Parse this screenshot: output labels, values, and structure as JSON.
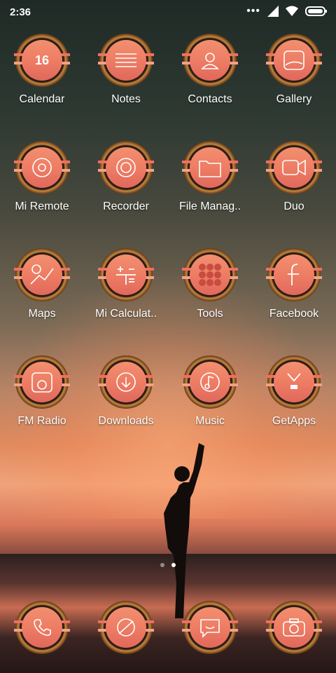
{
  "status": {
    "time": "2:36"
  },
  "apps": [
    [
      {
        "label": "Calendar",
        "icon": "calendar-icon",
        "badge": "16"
      },
      {
        "label": "Notes",
        "icon": "notes-icon"
      },
      {
        "label": "Contacts",
        "icon": "contacts-icon"
      },
      {
        "label": "Gallery",
        "icon": "gallery-icon"
      }
    ],
    [
      {
        "label": "Mi Remote",
        "icon": "remote-icon"
      },
      {
        "label": "Recorder",
        "icon": "recorder-icon"
      },
      {
        "label": "File Manag..",
        "icon": "folder-icon"
      },
      {
        "label": "Duo",
        "icon": "video-call-icon"
      }
    ],
    [
      {
        "label": "Maps",
        "icon": "maps-icon"
      },
      {
        "label": "Mi Calculat..",
        "icon": "calculator-icon"
      },
      {
        "label": "Tools",
        "icon": "tools-folder-icon"
      },
      {
        "label": "Facebook",
        "icon": "facebook-icon"
      }
    ],
    [
      {
        "label": "FM Radio",
        "icon": "radio-icon"
      },
      {
        "label": "Downloads",
        "icon": "download-icon"
      },
      {
        "label": "Music",
        "icon": "music-icon"
      },
      {
        "label": "GetApps",
        "icon": "store-icon"
      }
    ]
  ],
  "dock": [
    {
      "icon": "phone-icon"
    },
    {
      "icon": "browser-icon"
    },
    {
      "icon": "messaging-icon"
    },
    {
      "icon": "camera-icon"
    }
  ],
  "pages": {
    "count": 2,
    "current": 2
  }
}
